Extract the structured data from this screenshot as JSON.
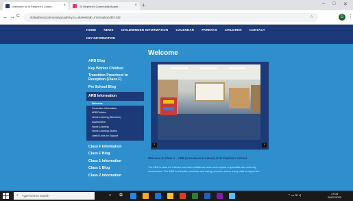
{
  "browser": {
    "tabs": [
      {
        "title": "Welcome to St Stephen's Comm...",
        "close": "×"
      },
      {
        "title": "St Stephen's Community Acade...",
        "close": "×"
      }
    ],
    "new_tab": "+",
    "window_controls": [
      "–",
      "□",
      "✕"
    ],
    "back": "←",
    "forward": "→",
    "reload": "C",
    "url": "ststephenscommunityacademy.co.uk/web/arb_information/357432",
    "star": "☆",
    "avatar_letter": "G",
    "menu": "⋮"
  },
  "site": {
    "nav": [
      "HOME",
      "NEWS",
      "CHILDMINDER INFORMATION",
      "CALENDAR",
      "PARENTS",
      "CHILDREN",
      "CONTACT"
    ],
    "nav_row2": "KEY INFORMATION"
  },
  "sidebar": {
    "items_top": [
      "ARB Blog",
      "Key Worker Children",
      "Transition Preschool to Reception (Class F)",
      "Pre School Blog"
    ],
    "active": "ARB Information",
    "submenu": [
      "Welcome",
      "Curriculum Information",
      "ARB Policies",
      "Home Learning (Structure)",
      "Assessment",
      "Home Learning",
      "Home Learning Stories",
      "Useful Links for Support"
    ],
    "items_bottom": [
      "Class F Information",
      "Class F Blog",
      "Class 1 Information",
      "Class 1 Blog",
      "Class 2 Information"
    ]
  },
  "main": {
    "title": "Welcome",
    "slide_prev": "‹",
    "slide_next": "›",
    "caption": "Welcome to Class 1 – ARB (Area Resource Base) at St Stephen's School",
    "body": "The ARB is base for children who have additional needs and require a specialist and nurturing environment. The ARB is a flexible, inclusive and caring provision where every child is supported."
  },
  "taskbar": {
    "search_placeholder": "Type here to search",
    "time": "17:03",
    "date": "20/07/2020"
  }
}
